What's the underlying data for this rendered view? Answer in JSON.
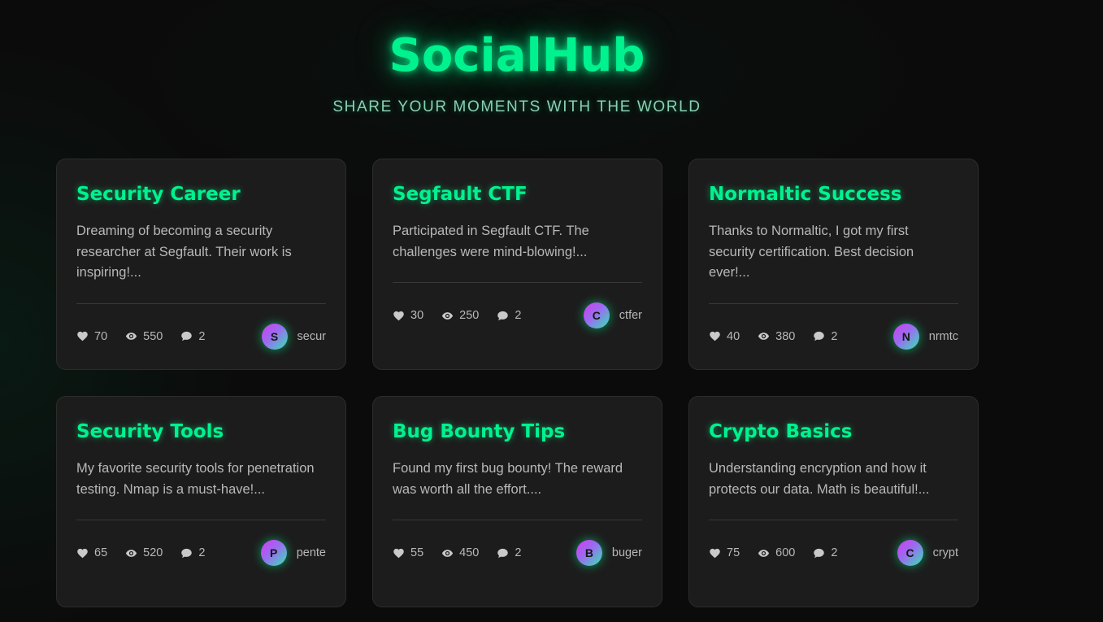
{
  "header": {
    "brand": "SocialHub",
    "tagline": "SHARE YOUR MOMENTS WITH THE WORLD"
  },
  "colors": {
    "accent": "#00f28e",
    "card_bg": "#1c1c1c",
    "page_bg": "#0b0b0b"
  },
  "icons": {
    "likes": "heart-icon",
    "views": "eye-icon",
    "comments": "comment-icon"
  },
  "posts": [
    {
      "title": "Security Career",
      "excerpt": "Dreaming of becoming a security researcher at Segfault. Their work is inspiring!...",
      "likes": "70",
      "views": "550",
      "comments": "2",
      "avatar_initial": "S",
      "author": "secur"
    },
    {
      "title": "Segfault CTF",
      "excerpt": "Participated in Segfault CTF. The challenges were mind-blowing!...",
      "likes": "30",
      "views": "250",
      "comments": "2",
      "avatar_initial": "C",
      "author": "ctfer"
    },
    {
      "title": "Normaltic Success",
      "excerpt": "Thanks to Normaltic, I got my first security certification. Best decision ever!...",
      "likes": "40",
      "views": "380",
      "comments": "2",
      "avatar_initial": "N",
      "author": "nrmtc"
    },
    {
      "title": "Security Tools",
      "excerpt": "My favorite security tools for penetration testing. Nmap is a must-have!...",
      "likes": "65",
      "views": "520",
      "comments": "2",
      "avatar_initial": "P",
      "author": "pente"
    },
    {
      "title": "Bug Bounty Tips",
      "excerpt": "Found my first bug bounty! The reward was worth all the effort....",
      "likes": "55",
      "views": "450",
      "comments": "2",
      "avatar_initial": "B",
      "author": "buger"
    },
    {
      "title": "Crypto Basics",
      "excerpt": "Understanding encryption and how it protects our data. Math is beautiful!...",
      "likes": "75",
      "views": "600",
      "comments": "2",
      "avatar_initial": "C",
      "author": "crypt"
    }
  ]
}
